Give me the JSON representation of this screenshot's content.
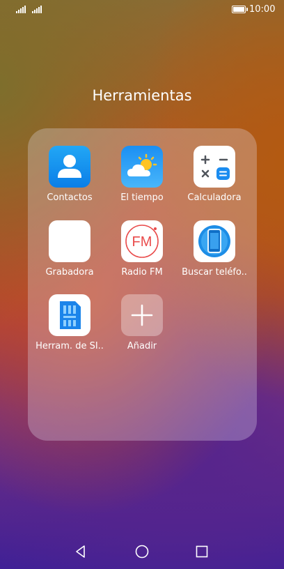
{
  "status_bar": {
    "time": "10:00",
    "icons": [
      "signal-icon",
      "signal-icon",
      "battery-icon"
    ]
  },
  "folder": {
    "title": "Herramientas",
    "apps": [
      {
        "label": "Contactos",
        "icon": "contacts-icon"
      },
      {
        "label": "El tiempo",
        "icon": "weather-icon"
      },
      {
        "label": "Calculadora",
        "icon": "calculator-icon"
      },
      {
        "label": "Grabadora",
        "icon": "recorder-icon"
      },
      {
        "label": "Radio FM",
        "icon": "radio-fm-icon",
        "icon_text": "FM"
      },
      {
        "label": "Buscar teléfo..",
        "icon": "find-phone-icon"
      },
      {
        "label": "Herram. de SI..",
        "icon": "sim-card-icon"
      },
      {
        "label": "Añadir",
        "icon": "add-icon"
      }
    ]
  },
  "nav_bar": {
    "buttons": [
      "back-icon",
      "home-icon",
      "recents-icon"
    ]
  },
  "colors": {
    "contacts_blue": "#0b7ee8",
    "calculator_blue": "#1a8cf0",
    "fm_red": "#e94b4b"
  }
}
